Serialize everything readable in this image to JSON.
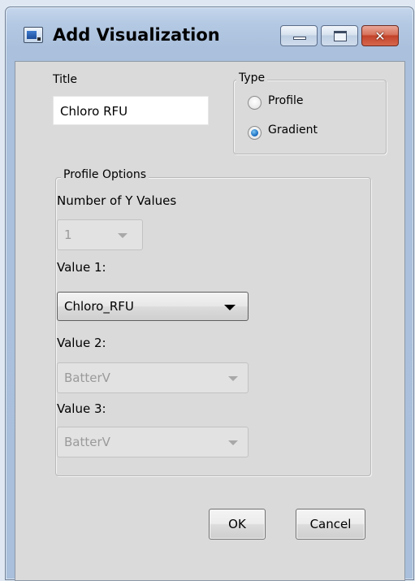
{
  "window": {
    "title": "Add Visualization",
    "icon": "app-window-icon",
    "controls": {
      "minimize_icon": "minimize-icon",
      "maximize_icon": "maximize-icon",
      "close_glyph": "✕"
    }
  },
  "form": {
    "title_label": "Title",
    "title_value": "Chloro RFU",
    "type_group": {
      "label": "Type",
      "options": [
        {
          "label": "Profile",
          "checked": false
        },
        {
          "label": "Gradient",
          "checked": true
        }
      ]
    },
    "profile_options": {
      "label": "Profile Options",
      "num_y_label": "Number of Y Values",
      "num_y_value": "1",
      "value1_label": "Value 1:",
      "value1_selected": "Chloro_RFU",
      "value2_label": "Value 2:",
      "value2_selected": "BatterV",
      "value3_label": "Value 3:",
      "value3_selected": "BatterV"
    }
  },
  "buttons": {
    "ok": "OK",
    "cancel": "Cancel"
  },
  "colors": {
    "accent_radio": "#1f73c4",
    "client_bg": "#dadada",
    "titlebar": "#b4c9e3",
    "close_button": "#c2432a"
  }
}
